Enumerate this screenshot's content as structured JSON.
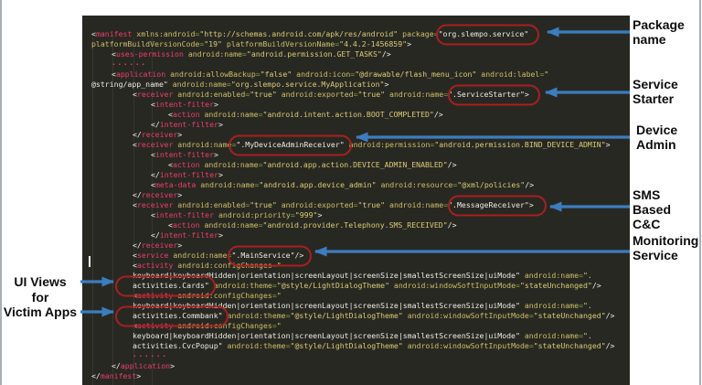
{
  "annotations": {
    "right": [
      {
        "label": "Package\nname"
      },
      {
        "label": "Service\nStarter"
      },
      {
        "label": "Device\nAdmin"
      },
      {
        "label": "SMS Based\nC&C"
      },
      {
        "label": "Monitoring\nService"
      }
    ],
    "left": {
      "label": "UI Views\nfor\nVictim Apps"
    }
  },
  "highlights": [
    "org.slempo.service",
    ".ServiceStarter",
    ".MyDeviceAdminReceiver",
    ".MessageReceiver",
    ".MainService",
    "activities.Cards",
    "activities.Commbank"
  ],
  "colors": {
    "panel_bg": "#282823",
    "tag": "#ee3d66",
    "attribute": "#cdbf66",
    "equals": "#84a33c",
    "value": "#d9cc74",
    "plain": "#eceae2",
    "highlight_red": "#a8201f",
    "arrow_blue": "#3b7dbf",
    "label_text": "#0d0d0d"
  },
  "code": {
    "lines": [
      {
        "i": 0,
        "s": [
          [
            "p",
            "<"
          ],
          [
            "t",
            "manifest"
          ],
          [
            "a",
            " xmlns:android"
          ],
          [
            "e",
            "="
          ],
          [
            "v",
            "\"http://schemas.android.com/apk/res/android\""
          ],
          [
            "a",
            " package"
          ],
          [
            "e",
            "="
          ],
          [
            "p",
            "\"org.slempo.service\""
          ]
        ]
      },
      {
        "i": 0,
        "s": [
          [
            "a",
            "platformBuildVersionCode"
          ],
          [
            "e",
            "="
          ],
          [
            "v",
            "\"19\""
          ],
          [
            "a",
            " platformBuildVersionName"
          ],
          [
            "e",
            "="
          ],
          [
            "v",
            "\"4.4.2-1456859\""
          ],
          [
            "p",
            ">"
          ]
        ]
      },
      {
        "i": 1,
        "s": [
          [
            "p",
            "<"
          ],
          [
            "t",
            "uses-permission"
          ],
          [
            "a",
            " android:name"
          ],
          [
            "e",
            "="
          ],
          [
            "v",
            "\"android.permission.GET_TASKS\""
          ],
          [
            "p",
            "/>"
          ]
        ]
      },
      {
        "i": 1,
        "s": [
          [
            "d",
            "······"
          ]
        ]
      },
      {
        "i": 1,
        "s": [
          [
            "p",
            "<"
          ],
          [
            "t",
            "application"
          ],
          [
            "a",
            " android:allowBackup"
          ],
          [
            "e",
            "="
          ],
          [
            "v",
            "\"false\""
          ],
          [
            "a",
            " android:icon"
          ],
          [
            "e",
            "="
          ],
          [
            "v",
            "\"@drawable/flash_menu_icon\""
          ],
          [
            "a",
            " android:label"
          ],
          [
            "e",
            "="
          ],
          [
            "v",
            "\""
          ]
        ]
      },
      {
        "i": 0,
        "s": [
          [
            "p",
            "@string/app_name\""
          ],
          [
            "a",
            " android:name"
          ],
          [
            "e",
            "="
          ],
          [
            "v",
            "\"org.slempo.service.MyApplication\""
          ],
          [
            "p",
            ">"
          ]
        ]
      },
      {
        "i": 2,
        "s": [
          [
            "p",
            "<"
          ],
          [
            "t",
            "receiver"
          ],
          [
            "a",
            " android:enabled"
          ],
          [
            "e",
            "="
          ],
          [
            "v",
            "\"true\""
          ],
          [
            "a",
            " android:exported"
          ],
          [
            "e",
            "="
          ],
          [
            "v",
            "\"true\""
          ],
          [
            "a",
            " android:name"
          ],
          [
            "e",
            "="
          ],
          [
            "p",
            "\".ServiceStarter\">"
          ]
        ]
      },
      {
        "i": 3,
        "s": [
          [
            "p",
            "<"
          ],
          [
            "t",
            "intent-filter"
          ],
          [
            "p",
            ">"
          ]
        ]
      },
      {
        "i": 4,
        "s": [
          [
            "p",
            "<"
          ],
          [
            "t",
            "action"
          ],
          [
            "a",
            " android:name"
          ],
          [
            "e",
            "="
          ],
          [
            "v",
            "\"android.intent.action.BOOT_COMPLETED\""
          ],
          [
            "p",
            "/>"
          ]
        ]
      },
      {
        "i": 3,
        "s": [
          [
            "p",
            "</"
          ],
          [
            "t",
            "intent-filter"
          ],
          [
            "p",
            ">"
          ]
        ]
      },
      {
        "i": 2,
        "s": [
          [
            "p",
            "</"
          ],
          [
            "t",
            "receiver"
          ],
          [
            "p",
            ">"
          ]
        ]
      },
      {
        "i": 2,
        "s": [
          [
            "p",
            "<"
          ],
          [
            "t",
            "receiver"
          ],
          [
            "a",
            " android:name"
          ],
          [
            "e",
            "="
          ],
          [
            "p",
            "\".MyDeviceAdminReceiver\""
          ],
          [
            "a",
            " android:permission"
          ],
          [
            "e",
            "="
          ],
          [
            "v",
            "\"android.permission.BIND_DEVICE_ADMIN\""
          ],
          [
            "p",
            ">"
          ]
        ]
      },
      {
        "i": 3,
        "s": [
          [
            "p",
            "<"
          ],
          [
            "t",
            "intent-filter"
          ],
          [
            "p",
            ">"
          ]
        ]
      },
      {
        "i": 4,
        "s": [
          [
            "p",
            "<"
          ],
          [
            "t",
            "action"
          ],
          [
            "a",
            " android:name"
          ],
          [
            "e",
            "="
          ],
          [
            "v",
            "\"android.app.action.DEVICE_ADMIN_ENABLED\""
          ],
          [
            "p",
            "/>"
          ]
        ]
      },
      {
        "i": 3,
        "s": [
          [
            "p",
            "</"
          ],
          [
            "t",
            "intent-filter"
          ],
          [
            "p",
            ">"
          ]
        ]
      },
      {
        "i": 3,
        "s": [
          [
            "p",
            "<"
          ],
          [
            "t",
            "meta-data"
          ],
          [
            "a",
            " android:name"
          ],
          [
            "e",
            "="
          ],
          [
            "v",
            "\"android.app.device_admin\""
          ],
          [
            "a",
            " android:resource"
          ],
          [
            "e",
            "="
          ],
          [
            "v",
            "\"@xml/policies\""
          ],
          [
            "p",
            "/>"
          ]
        ]
      },
      {
        "i": 2,
        "s": [
          [
            "p",
            "</"
          ],
          [
            "t",
            "receiver"
          ],
          [
            "p",
            ">"
          ]
        ]
      },
      {
        "i": 2,
        "s": [
          [
            "p",
            "<"
          ],
          [
            "t",
            "receiver"
          ],
          [
            "a",
            " android:enabled"
          ],
          [
            "e",
            "="
          ],
          [
            "v",
            "\"true\""
          ],
          [
            "a",
            " android:exported"
          ],
          [
            "e",
            "="
          ],
          [
            "v",
            "\"true\""
          ],
          [
            "a",
            " android:name"
          ],
          [
            "e",
            "="
          ],
          [
            "p",
            "\".MessageReceiver\">"
          ]
        ]
      },
      {
        "i": 3,
        "s": [
          [
            "p",
            "<"
          ],
          [
            "t",
            "intent-filter"
          ],
          [
            "a",
            " android:priority"
          ],
          [
            "e",
            "="
          ],
          [
            "v",
            "\"999\""
          ],
          [
            "p",
            ">"
          ]
        ]
      },
      {
        "i": 4,
        "s": [
          [
            "p",
            "<"
          ],
          [
            "t",
            "action"
          ],
          [
            "a",
            " android:name"
          ],
          [
            "e",
            "="
          ],
          [
            "v",
            "\"android.provider.Telephony.SMS_RECEIVED\""
          ],
          [
            "p",
            "/>"
          ]
        ]
      },
      {
        "i": 3,
        "s": [
          [
            "p",
            "</"
          ],
          [
            "t",
            "intent-filter"
          ],
          [
            "p",
            ">"
          ]
        ]
      },
      {
        "i": 2,
        "s": [
          [
            "p",
            "</"
          ],
          [
            "t",
            "receiver"
          ],
          [
            "p",
            ">"
          ]
        ]
      },
      {
        "i": 2,
        "s": [
          [
            "p",
            "<"
          ],
          [
            "t",
            "service"
          ],
          [
            "a",
            " android:name"
          ],
          [
            "e",
            "="
          ],
          [
            "p",
            "\".MainService\"/>"
          ]
        ]
      },
      {
        "i": 2,
        "s": [
          [
            "p",
            "<"
          ],
          [
            "t",
            "activity"
          ],
          [
            "a",
            " android:configChanges"
          ],
          [
            "e",
            "="
          ],
          [
            "v",
            "\""
          ]
        ]
      },
      {
        "i": 2,
        "s": [
          [
            "p",
            "keyboard|keyboardHidden|orientation|screenLayout|screenSize|smallestScreenSize|uiMode\""
          ],
          [
            "a",
            " android:name"
          ],
          [
            "e",
            "="
          ],
          [
            "v",
            "\"."
          ]
        ]
      },
      {
        "i": 2,
        "s": [
          [
            "p",
            "activities.Cards\""
          ],
          [
            "a",
            " android:theme"
          ],
          [
            "e",
            "="
          ],
          [
            "v",
            "\"@style/LightDialogTheme\""
          ],
          [
            "a",
            " android:windowSoftInputMode"
          ],
          [
            "e",
            "="
          ],
          [
            "v",
            "\"stateUnchanged\""
          ],
          [
            "p",
            "/>"
          ]
        ]
      },
      {
        "i": 2,
        "s": [
          [
            "p",
            "<"
          ],
          [
            "t",
            "activity"
          ],
          [
            "a",
            " android:configChanges"
          ],
          [
            "e",
            "="
          ],
          [
            "v",
            "\""
          ]
        ]
      },
      {
        "i": 2,
        "s": [
          [
            "p",
            "keyboard|keyboardHidden|orientation|screenLayout|screenSize|smallestScreenSize|uiMode\""
          ],
          [
            "a",
            " android:name"
          ],
          [
            "e",
            "="
          ],
          [
            "v",
            "\"."
          ]
        ]
      },
      {
        "i": 2,
        "s": [
          [
            "p",
            "activities.Commbank\""
          ],
          [
            "a",
            " android:theme"
          ],
          [
            "e",
            "="
          ],
          [
            "v",
            "\"@style/LightDialogTheme\""
          ],
          [
            "a",
            " android:windowSoftInputMode"
          ],
          [
            "e",
            "="
          ],
          [
            "v",
            "\"stateUnchanged\""
          ],
          [
            "p",
            "/>"
          ]
        ]
      },
      {
        "i": 2,
        "s": [
          [
            "p",
            "<"
          ],
          [
            "t",
            "activity"
          ],
          [
            "a",
            " android:configChanges"
          ],
          [
            "e",
            "="
          ],
          [
            "v",
            "\""
          ]
        ]
      },
      {
        "i": 2,
        "s": [
          [
            "p",
            "keyboard|keyboardHidden|orientation|screenLayout|screenSize|smallestScreenSize|uiMode\""
          ],
          [
            "a",
            " android:name"
          ],
          [
            "e",
            "="
          ],
          [
            "v",
            "\"."
          ]
        ]
      },
      {
        "i": 2,
        "s": [
          [
            "p",
            "activities.CvcPopup\""
          ],
          [
            "a",
            " android:theme"
          ],
          [
            "e",
            "="
          ],
          [
            "v",
            "\"@style/LightDialogTheme\""
          ],
          [
            "a",
            " android:windowSoftInputMode"
          ],
          [
            "e",
            "="
          ],
          [
            "v",
            "\"stateUnchanged\""
          ],
          [
            "p",
            "/>"
          ]
        ]
      },
      {
        "i": 2,
        "s": [
          [
            "d",
            "······"
          ]
        ]
      },
      {
        "i": 1,
        "s": [
          [
            "p",
            "</"
          ],
          [
            "t",
            "application"
          ],
          [
            "p",
            ">"
          ]
        ]
      },
      {
        "i": 0,
        "s": [
          [
            "p",
            "</"
          ],
          [
            "t",
            "manifest"
          ],
          [
            "p",
            ">"
          ]
        ]
      }
    ]
  }
}
